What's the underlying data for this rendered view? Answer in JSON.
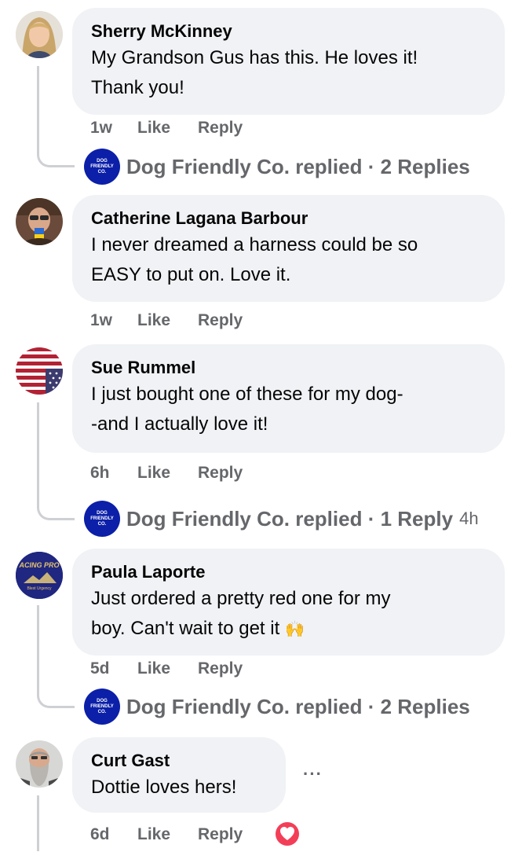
{
  "comments": [
    {
      "name": "Sherry McKinney",
      "text_lines": [
        "My Grandson Gus has this. He loves it!",
        "Thank you!"
      ],
      "time": "1w",
      "like": "Like",
      "reply": "Reply",
      "replies_line": {
        "author": "Dog Friendly Co.",
        "text": "Dog Friendly Co. replied · 2 Replies",
        "time": ""
      }
    },
    {
      "name": "Catherine Lagana Barbour",
      "text_lines": [
        "I never dreamed a harness could be so",
        "EASY to put on. Love it."
      ],
      "time": "1w",
      "like": "Like",
      "reply": "Reply"
    },
    {
      "name": "Sue Rummel",
      "text_lines": [
        "I just bought one of these for my dog-",
        "-and I actually love it!"
      ],
      "time": "6h",
      "like": "Like",
      "reply": "Reply",
      "replies_line": {
        "author": "Dog Friendly Co.",
        "text": "Dog Friendly Co. replied · 1 Reply",
        "time": "4h"
      }
    },
    {
      "name": "Paula Laporte",
      "text_lines": [
        "Just ordered a pretty red one for my",
        "boy. Can't wait to get it"
      ],
      "emoji": "🙌",
      "time": "5d",
      "like": "Like",
      "reply": "Reply",
      "replies_line": {
        "author": "Dog Friendly Co.",
        "text": "Dog Friendly Co. replied · 2 Replies",
        "time": ""
      }
    },
    {
      "name": "Curt Gast",
      "text_lines": [
        "Dottie loves hers!"
      ],
      "time": "6d",
      "like": "Like",
      "reply": "Reply",
      "more": "···"
    }
  ],
  "brand_logo_text": [
    "DOG",
    "FRIENDLY",
    "CO."
  ],
  "paula_avatar_text": {
    "top": "ACING PRO",
    "bottom": "Blest Urgency"
  },
  "colors": {
    "bubble": "#f0f2f5",
    "meta_gray": "#65676b",
    "brand_blue": "#0b1fa8",
    "thread_line": "#ced0d4",
    "love_reaction": "#f33e58"
  }
}
